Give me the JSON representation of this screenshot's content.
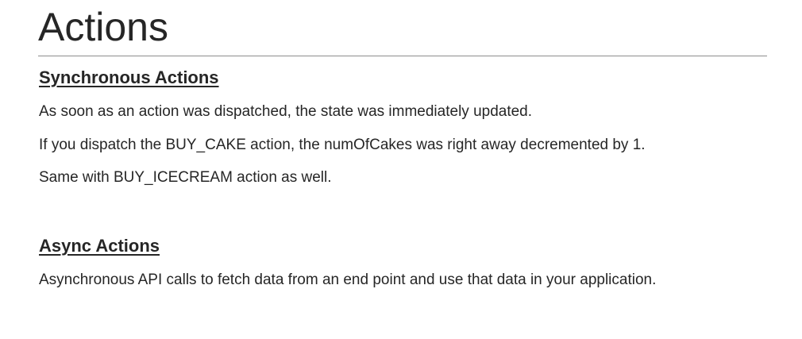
{
  "slide": {
    "title": "Actions",
    "sections": [
      {
        "heading": "Synchronous Actions",
        "lines": [
          "As soon as an action was dispatched, the state was immediately updated.",
          "If you dispatch the BUY_CAKE action, the numOfCakes was right away decremented by 1.",
          "Same with BUY_ICECREAM action as well."
        ]
      },
      {
        "heading": "Async Actions",
        "lines": [
          "Asynchronous API calls to fetch data from an end point and use that data in your application."
        ]
      }
    ]
  }
}
